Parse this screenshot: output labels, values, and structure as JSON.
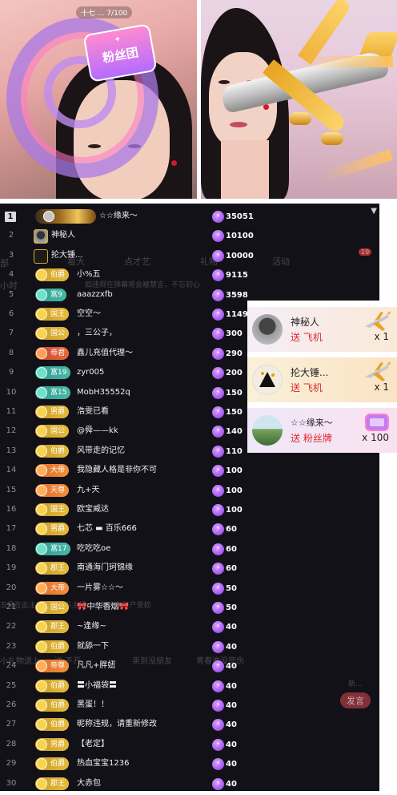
{
  "stream_left": {
    "counter_text": "十七 ... 7/100",
    "badge_text": "粉丝团"
  },
  "board": {
    "ghost_texts": [
      "部",
      "看大",
      "点才艺",
      "礼物",
      "活动",
      "19",
      "小时",
      "如违规在弹幕将会被禁言，不忘初心",
      "五号在此主播请...联系主播、以免个人财产受损",
      "小礼物送上",
      "送 不开...",
      "卖到没朋友",
      "青春谁没悲伤",
      "新...",
      "发言"
    ],
    "rows": [
      {
        "rank": "1",
        "badge": "",
        "name": "☆☆缘来～",
        "score": "35051"
      },
      {
        "rank": "2",
        "badge": "",
        "name": "神秘人",
        "score": "10100"
      },
      {
        "rank": "3",
        "badge": "",
        "name": "抡大锤...",
        "score": "10000"
      },
      {
        "rank": "4",
        "badge": "伯爵",
        "name": "小%五",
        "score": "9115"
      },
      {
        "rank": "5",
        "badge": "富9",
        "name": "aaazzxfb",
        "score": "3598"
      },
      {
        "rank": "6",
        "badge": "国王",
        "name": "空空～",
        "score": "1149"
      },
      {
        "rank": "7",
        "badge": "国公",
        "name": "，三公子，",
        "score": "300"
      },
      {
        "rank": "8",
        "badge": "帝君",
        "name": "鑫儿充值代理～",
        "score": "290"
      },
      {
        "rank": "9",
        "badge": "富19",
        "name": "zyr005",
        "score": "200"
      },
      {
        "rank": "10",
        "badge": "富15",
        "name": "MobH35552q",
        "score": "150"
      },
      {
        "rank": "11",
        "badge": "男爵",
        "name": "浩雯已看",
        "score": "150"
      },
      {
        "rank": "12",
        "badge": "国公",
        "name": "@舜——kk",
        "score": "140"
      },
      {
        "rank": "13",
        "badge": "伯爵",
        "name": "风带走的记忆",
        "score": "110"
      },
      {
        "rank": "14",
        "badge": "大帝",
        "name": "我隐藏人格是非你不可",
        "score": "100"
      },
      {
        "rank": "15",
        "badge": "天尊",
        "name": "九+天",
        "score": "100"
      },
      {
        "rank": "16",
        "badge": "国王",
        "name": "欧宝威达",
        "score": "100"
      },
      {
        "rank": "17",
        "badge": "男爵",
        "name": "七芯 ▬ 百乐666",
        "score": "60"
      },
      {
        "rank": "18",
        "badge": "富17",
        "name": "吃吃吃oe",
        "score": "60"
      },
      {
        "rank": "19",
        "badge": "郡王",
        "name": "南通海门珂锦缘",
        "score": "60"
      },
      {
        "rank": "20",
        "badge": "大帝",
        "name": "一片雾☆☆～",
        "score": "50"
      },
      {
        "rank": "21",
        "badge": "国公",
        "name": "🎀中华香烟🎀",
        "score": "50"
      },
      {
        "rank": "22",
        "badge": "郡王",
        "name": "~逢缘~",
        "score": "40"
      },
      {
        "rank": "23",
        "badge": "伯爵",
        "name": "就舔一下",
        "score": "40"
      },
      {
        "rank": "24",
        "badge": "帝尊",
        "name": "凡凡+胖妞",
        "score": "40"
      },
      {
        "rank": "25",
        "badge": "伯爵",
        "name": "〓小福袋〓",
        "score": "40"
      },
      {
        "rank": "26",
        "badge": "伯爵",
        "name": "黑蛋！！",
        "score": "40"
      },
      {
        "rank": "27",
        "badge": "伯爵",
        "name": "昵称违规，请重新修改",
        "score": "40"
      },
      {
        "rank": "28",
        "badge": "男爵",
        "name": "【老定】",
        "score": "40"
      },
      {
        "rank": "29",
        "badge": "伯爵",
        "name": "热血宝宝1236",
        "score": "40"
      },
      {
        "rank": "30",
        "badge": "郡王",
        "name": "大赤包",
        "score": "40"
      }
    ]
  },
  "gifts": [
    {
      "name": "神秘人",
      "action": "送 飞机",
      "count": "x 1",
      "icon": "airplane-icon"
    },
    {
      "name": "抡大锤...",
      "action": "送 飞机",
      "count": "x 1",
      "icon": "airplane-icon"
    },
    {
      "name": "☆☆缘来～",
      "action": "送 粉丝牌",
      "count": "x 100",
      "icon": "fan-badge-icon"
    }
  ],
  "colors": {
    "board_bg": "#121117",
    "bolt": "#8b3bea",
    "gift_send": "#e0292f",
    "gold_badge": "#d8aa30",
    "teal_badge": "#3aa898"
  }
}
